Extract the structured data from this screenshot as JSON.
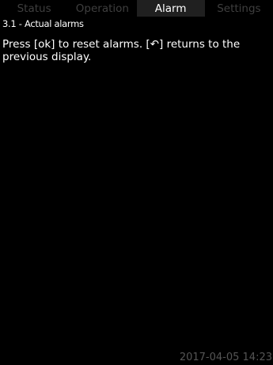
{
  "tabs": [
    {
      "label": "Status",
      "active": false
    },
    {
      "label": "Operation",
      "active": false
    },
    {
      "label": "Alarm",
      "active": true
    },
    {
      "label": "Settings",
      "active": false
    }
  ],
  "breadcrumb": "3.1 - Actual alarms",
  "message": "Press [ok] to reset alarms. [↶] returns to the previous display.",
  "datetime": "2017-04-05 14:23",
  "colors": {
    "background": "#000000",
    "active_tab": "#202020",
    "inactive_tab_text": "#3f3f3f",
    "text": "#ffffff",
    "footer_text": "#555555"
  }
}
